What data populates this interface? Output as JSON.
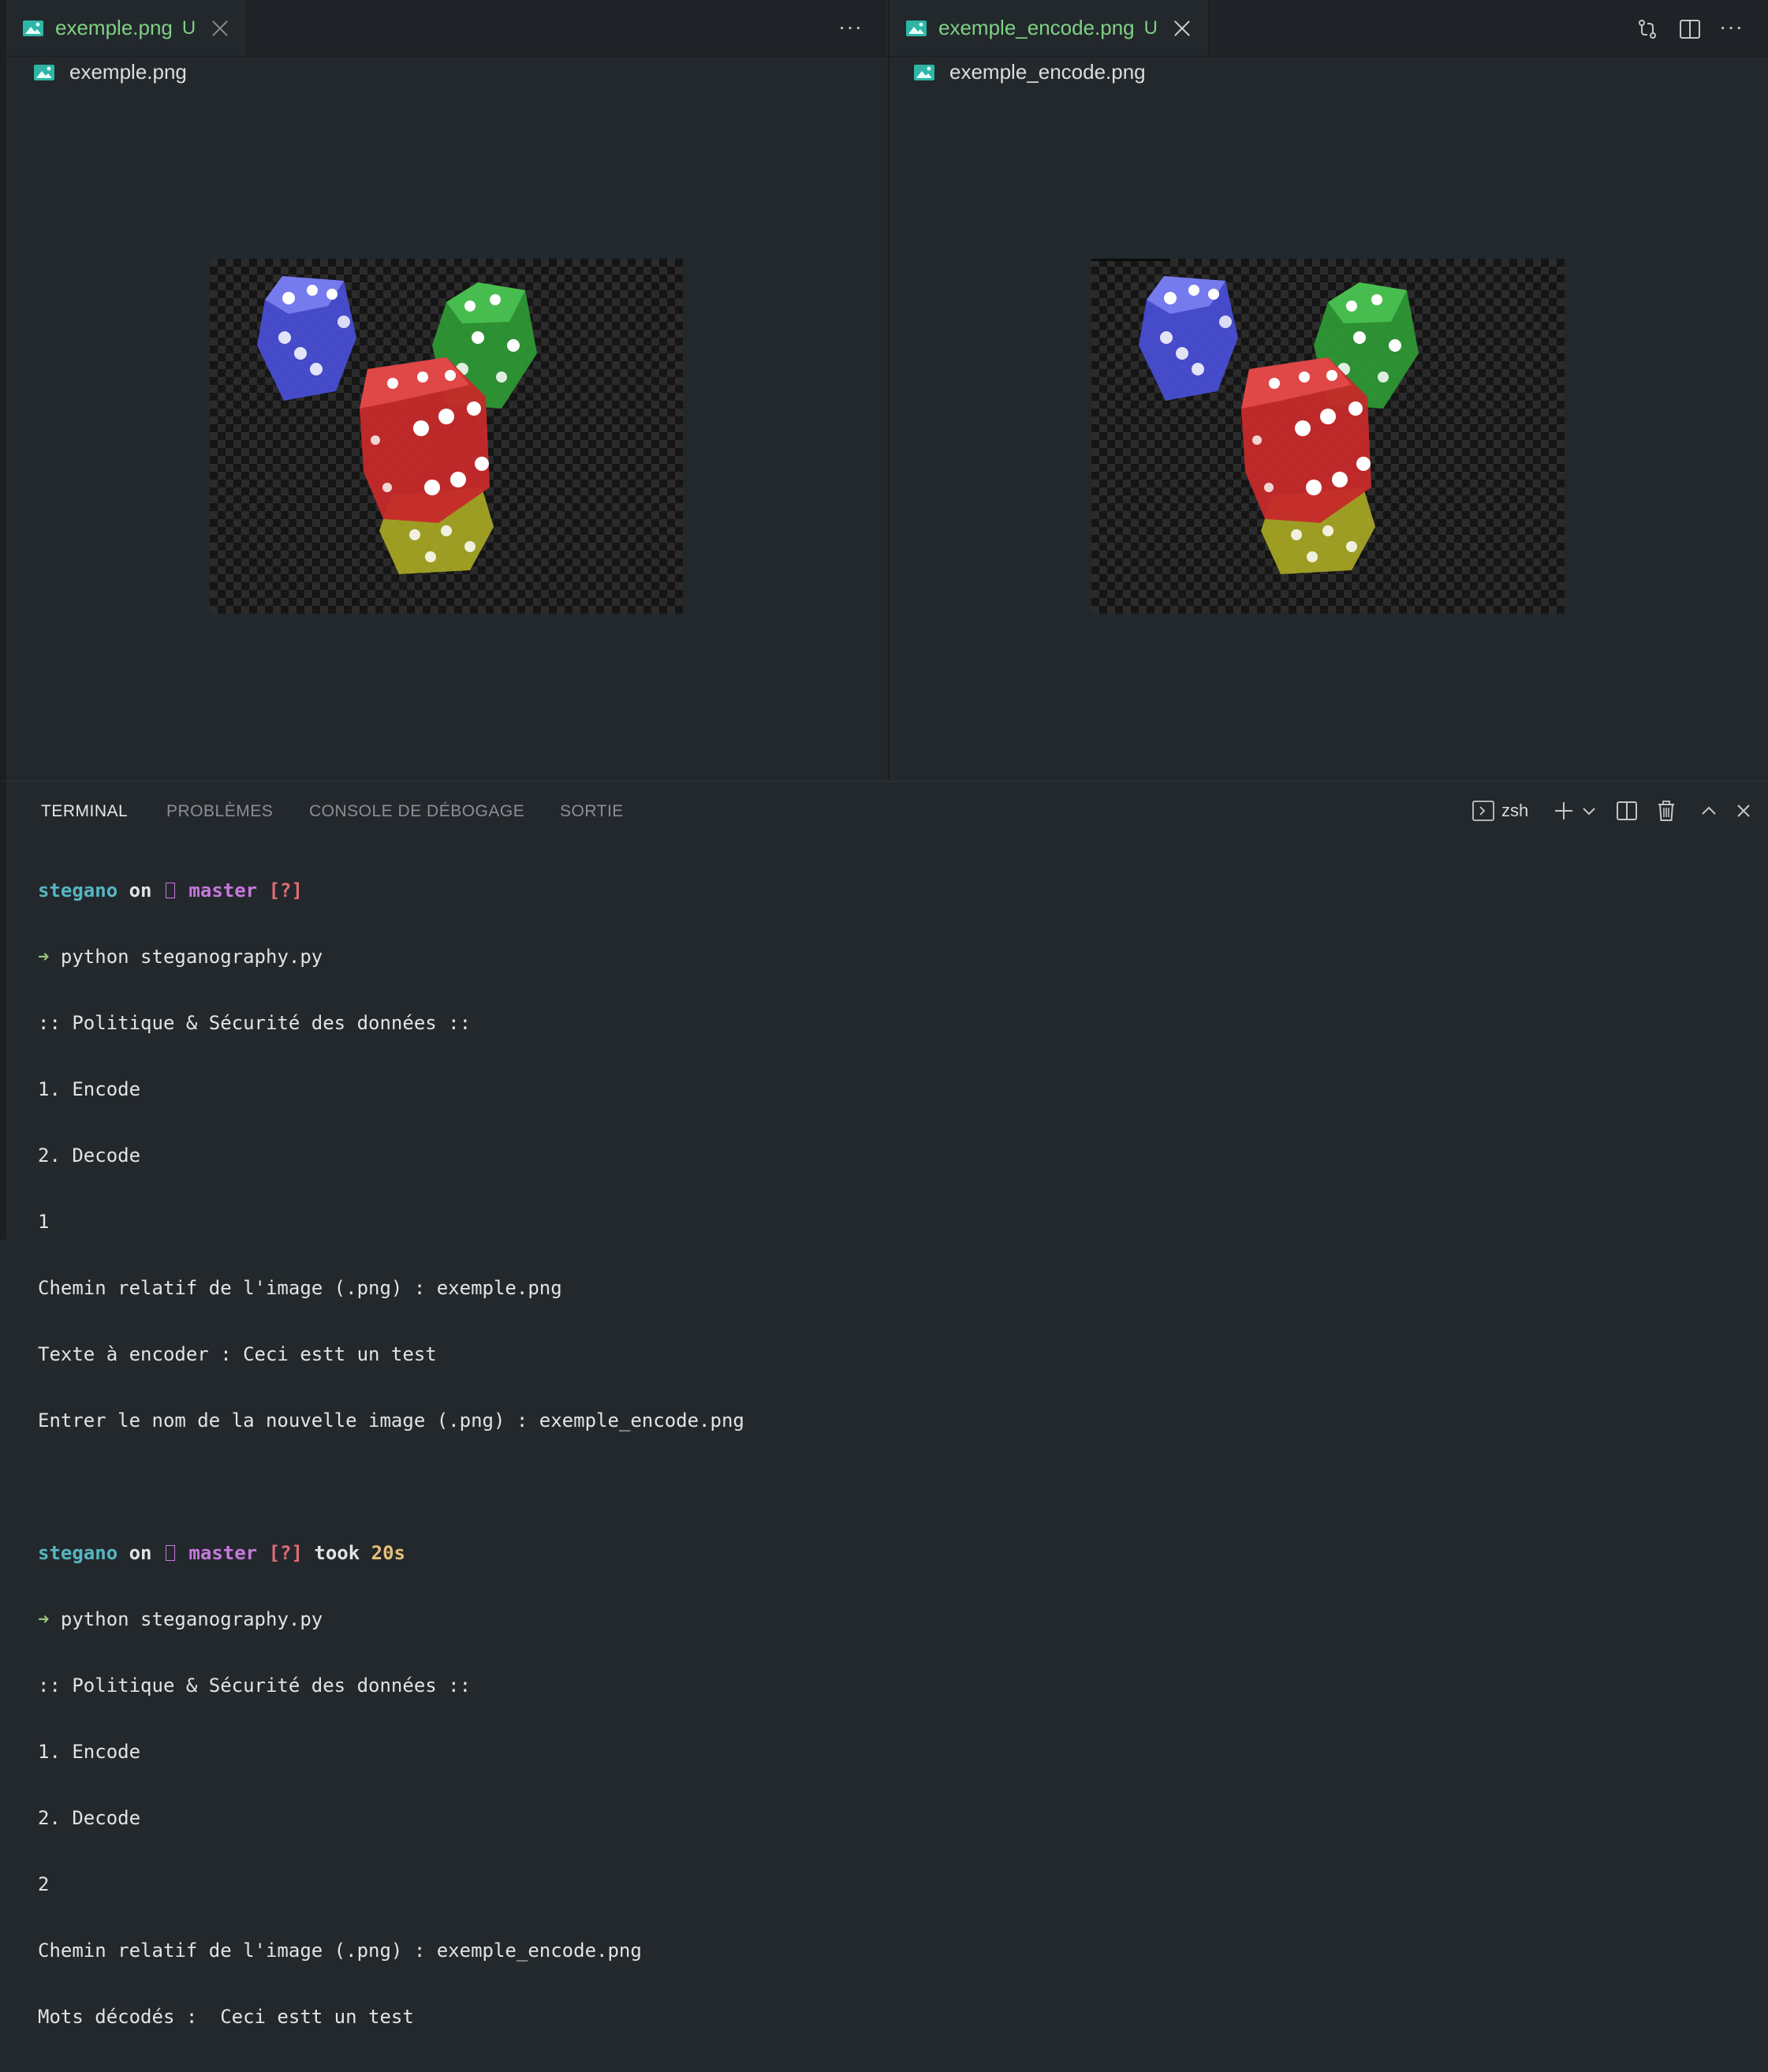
{
  "editor": {
    "left": {
      "tab": {
        "label": "exemple.png",
        "flag": "U"
      },
      "breadcrumb": "exemple.png",
      "more": "···"
    },
    "right": {
      "tab": {
        "label": "exemple_encode.png",
        "flag": "U"
      },
      "breadcrumb": "exemple_encode.png",
      "more": "···"
    }
  },
  "panel": {
    "tabs": [
      "TERMINAL",
      "PROBLÈMES",
      "CONSOLE DE DÉBOGAGE",
      "SORTIE"
    ],
    "shell": "zsh"
  },
  "terminal": {
    "prompt1": {
      "dir": "stegano",
      "on": "on",
      "branch": "master",
      "status": "[?]"
    },
    "session1": [
      "python steganography.py",
      ":: Politique & Sécurité des données ::",
      "1. Encode",
      "2. Decode",
      "1",
      "Chemin relatif de l'image (.png) : exemple.png",
      "Texte à encoder : Ceci estt un test",
      "Entrer le nom de la nouvelle image (.png) : exemple_encode.png"
    ],
    "prompt2": {
      "dir": "stegano",
      "on": "on",
      "branch": "master",
      "status": "[?]",
      "took": "took",
      "time": "20s"
    },
    "session2": [
      "python steganography.py",
      ":: Politique & Sécurité des données ::",
      "1. Encode",
      "2. Decode",
      "2",
      "Chemin relatif de l'image (.png) : exemple_encode.png",
      "Mots décodés :  Ceci estt un test"
    ],
    "arrow": "➜"
  },
  "colors": {
    "tab_text": "#7fd184",
    "dir": "#56b6c2",
    "branch": "#c678dd",
    "status": "#e06c75",
    "time": "#e5c07b"
  }
}
